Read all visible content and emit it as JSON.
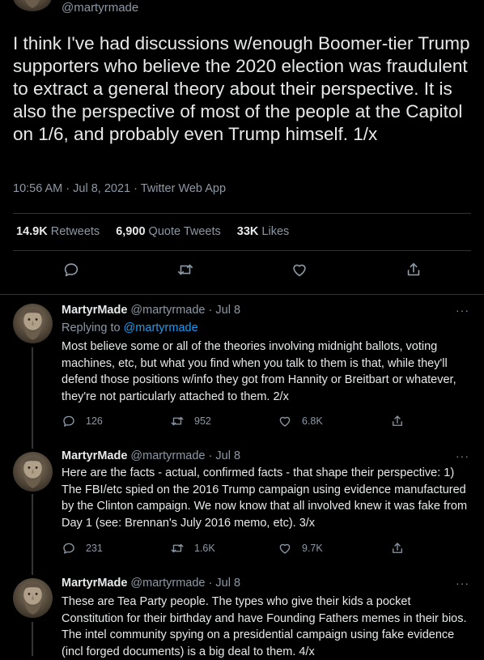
{
  "main_tweet": {
    "handle": "@martyrmade",
    "text": "I think I've had discussions w/enough Boomer-tier Trump supporters who believe the 2020 election was fraudulent to extract a general theory about their perspective. It is also the perspective of most of the people at the Capitol on 1/6, and probably even Trump himself. 1/x",
    "meta": "10:56 AM · Jul 8, 2021 · Twitter Web App",
    "stats": {
      "retweets_count": "14.9K",
      "retweets_label": "Retweets",
      "quotes_count": "6,900",
      "quotes_label": "Quote Tweets",
      "likes_count": "33K",
      "likes_label": "Likes"
    }
  },
  "replies": [
    {
      "name": "MartyrMade",
      "handle_date": "@martyrmade · Jul 8",
      "more": "···",
      "replying_prefix": "Replying to ",
      "replying_to": "@martyrmade",
      "text": "Most believe some or all of the theories involving midnight ballots, voting machines, etc, but what you find when you talk to them is that, while they'll defend those positions w/info they got from Hannity or Breitbart or whatever, they're not particularly attached to them. 2/x",
      "replies": "126",
      "retweets": "952",
      "likes": "6.8K"
    },
    {
      "name": "MartyrMade",
      "handle_date": "@martyrmade · Jul 8",
      "more": "···",
      "text": "Here are the facts - actual, confirmed facts - that shape their perspective: 1) The FBI/etc spied on the 2016 Trump campaign using evidence manufactured by the Clinton campaign. We now know that all involved knew it was fake from Day 1 (see: Brennan's July 2016 memo, etc). 3/x",
      "replies": "231",
      "retweets": "1.6K",
      "likes": "9.7K"
    },
    {
      "name": "MartyrMade",
      "handle_date": "@martyrmade · Jul 8",
      "more": "···",
      "text": "These are Tea Party people. The types who give their kids a pocket Constitution for their birthday and have Founding Fathers memes in their bios. The intel community spying on a presidential campaign using fake evidence (incl forged documents) is a big deal to them. 4/x"
    }
  ],
  "icons": {
    "reply": "speech-bubble-icon",
    "retweet": "retweet-arrows-icon",
    "like": "heart-icon",
    "share": "share-upload-icon",
    "avatar": "bearded-statue-avatar"
  },
  "colors": {
    "background": "#000000",
    "text": "#e7e9ea",
    "muted": "#8b98a5",
    "link": "#1d9bf0",
    "divider": "#2f3336"
  }
}
